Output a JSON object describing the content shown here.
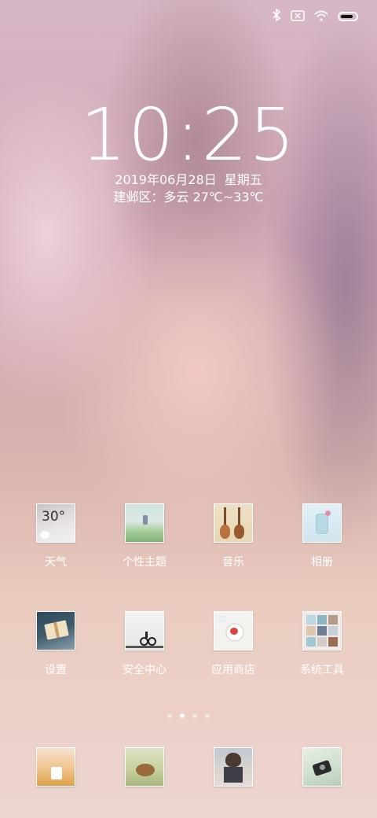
{
  "status_bar": {
    "icons": [
      "bluetooth-icon",
      "no-sim-icon",
      "wifi-icon",
      "battery-icon"
    ]
  },
  "lockclock": {
    "time": "10:25",
    "date": "2019年06月28日",
    "weekday": "星期五",
    "weather": "建邺区：多云 27℃~33℃"
  },
  "apps_row1": [
    {
      "label": "天气",
      "icon": "weather-icon",
      "temp": "30°"
    },
    {
      "label": "个性主题",
      "icon": "theme-icon"
    },
    {
      "label": "音乐",
      "icon": "music-icon"
    },
    {
      "label": "相册",
      "icon": "gallery-icon"
    }
  ],
  "apps_row2": [
    {
      "label": "设置",
      "icon": "settings-icon"
    },
    {
      "label": "安全中心",
      "icon": "security-icon"
    },
    {
      "label": "应用商店",
      "icon": "app-store-icon"
    },
    {
      "label": "系统工具",
      "icon": "system-tools-folder-icon"
    }
  ],
  "dock": [
    {
      "icon": "phone-icon"
    },
    {
      "icon": "messages-icon"
    },
    {
      "icon": "browser-icon"
    },
    {
      "icon": "camera-icon"
    }
  ],
  "page_indicator": {
    "count": 4,
    "active": 2
  }
}
